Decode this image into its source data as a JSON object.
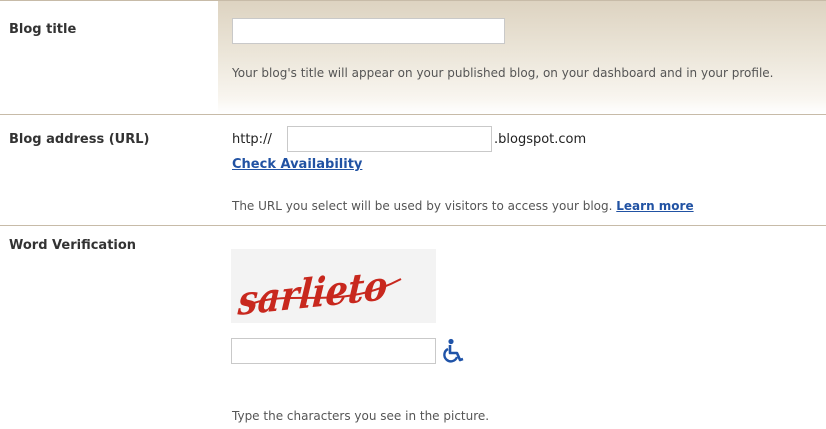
{
  "blog_title": {
    "label": "Blog title",
    "value": "",
    "help": "Your blog's title will appear on your published blog, on your dashboard and in your profile."
  },
  "blog_address": {
    "label": "Blog address (URL)",
    "prefix": "http://",
    "value": "",
    "suffix": ".blogspot.com",
    "check_link": "Check Availability",
    "help": "The URL you select will be used by visitors to access your blog.",
    "learn_more": "Learn more"
  },
  "word_verification": {
    "label": "Word Verification",
    "captcha_text": "sarlieto",
    "value": "",
    "accessibility_icon": "wheelchair-icon",
    "help": "Type the characters you see in the picture."
  },
  "colors": {
    "link": "#2152a3",
    "captcha_red": "#c8281e",
    "divider": "#c7bba8"
  }
}
